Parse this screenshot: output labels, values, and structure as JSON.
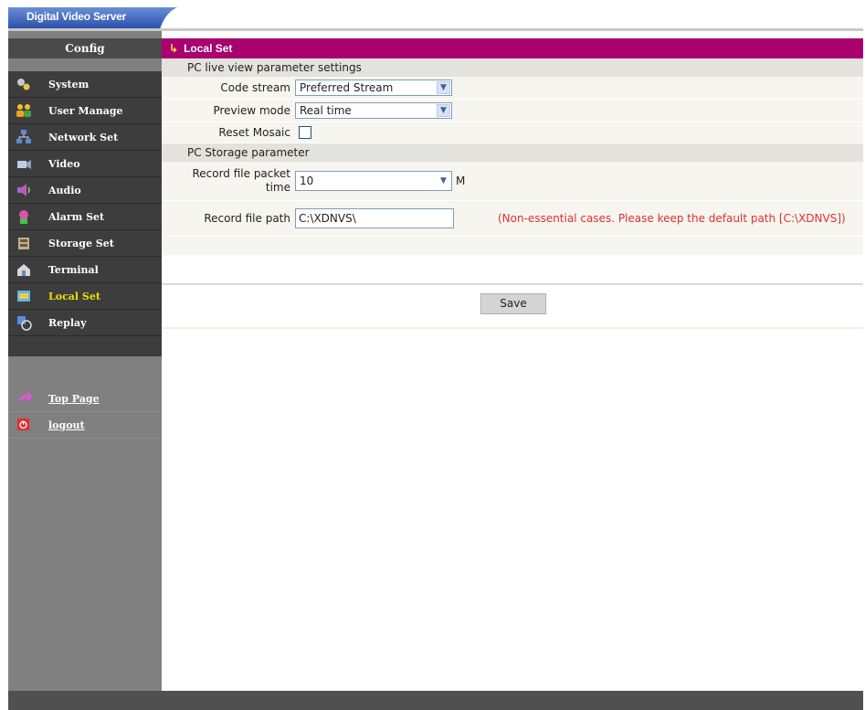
{
  "app": {
    "title": "Digital Video Server"
  },
  "sidebar": {
    "header": "Config",
    "items": [
      {
        "label": "System",
        "icon": "system-icon"
      },
      {
        "label": "User Manage",
        "icon": "users-icon"
      },
      {
        "label": "Network Set",
        "icon": "network-icon"
      },
      {
        "label": "Video",
        "icon": "video-icon"
      },
      {
        "label": "Audio",
        "icon": "audio-icon"
      },
      {
        "label": "Alarm Set",
        "icon": "alarm-icon"
      },
      {
        "label": "Storage Set",
        "icon": "storage-icon"
      },
      {
        "label": "Terminal",
        "icon": "terminal-icon"
      },
      {
        "label": "Local Set",
        "icon": "local-set-icon",
        "active": true
      },
      {
        "label": "Replay",
        "icon": "replay-icon"
      }
    ],
    "links": [
      {
        "label": "Top Page",
        "icon": "arrow-icon"
      },
      {
        "label": "logout",
        "icon": "power-icon"
      }
    ]
  },
  "main": {
    "title": "Local Set",
    "live_view": {
      "header": "PC live view parameter settings",
      "code_stream": {
        "label": "Code stream",
        "value": "Preferred Stream"
      },
      "preview_mode": {
        "label": "Preview mode",
        "value": "Real time"
      },
      "reset_mosaic": {
        "label": "Reset Mosaic",
        "checked": false
      }
    },
    "storage": {
      "header": "PC Storage parameter",
      "packet_time": {
        "label_line1": "Record file packet",
        "label_line2": "time",
        "value": "10",
        "unit": "M"
      },
      "file_path": {
        "label": "Record file path",
        "value": "C:\\XDNVS\\",
        "note": "(Non-essential cases. Please keep the default path [C:\\XDNVS])"
      }
    },
    "save_label": "Save"
  },
  "colors": {
    "accent": "#a8006f",
    "sidebar": "#808080",
    "menu": "#3d3d3d",
    "active_text": "#f0e000",
    "note": "#e03030"
  }
}
